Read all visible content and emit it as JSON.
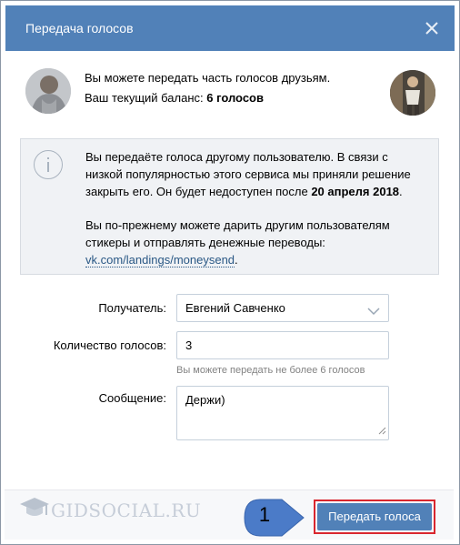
{
  "dialog": {
    "title": "Передача голосов",
    "close_icon": "close-icon"
  },
  "intro": {
    "line1": "Вы можете передать часть голосов друзьям.",
    "balance_prefix": "Ваш текущий баланс:",
    "balance_value": "6 голосов"
  },
  "notice": {
    "icon": "info-icon",
    "line1": "Вы передаёте голоса другому пользователю. В связи с",
    "line2": "низкой популярностью этого сервиса мы приняли решение",
    "line3_prefix": "закрыть его. Он будет недоступен после",
    "line3_date": "20 апреля 2018",
    "line3_suffix": ".",
    "line4": "Вы по-прежнему можете дарить другим пользователям",
    "line5": "стикеры и отправлять денежные переводы:",
    "link": "vk.com/landings/moneysend",
    "link_suffix": "."
  },
  "form": {
    "recipient_label": "Получатель:",
    "recipient_value": "Евгений Савченко",
    "votes_label": "Количество голосов:",
    "votes_value": "3",
    "votes_hint": "Вы можете передать не более 6 голосов",
    "message_label": "Сообщение:",
    "message_value": "Держи)"
  },
  "footer": {
    "watermark": "GIDSOCIAL.RU",
    "step_number": "1",
    "submit_label": "Передать голоса"
  },
  "colors": {
    "header": "#5181b8",
    "button": "#5181b8",
    "highlight_border": "#d9262e",
    "link": "#2a5885",
    "badge": "#4b7bc8"
  }
}
